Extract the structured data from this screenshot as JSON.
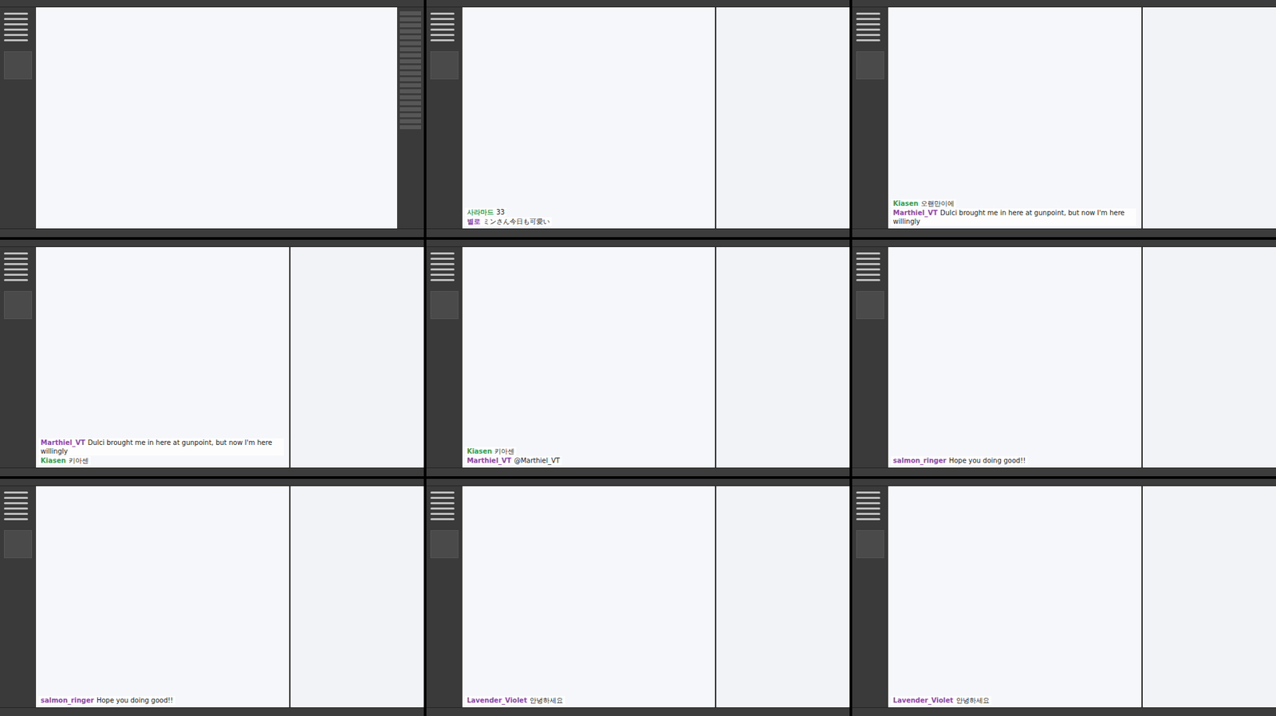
{
  "panels": [
    {
      "reference": false,
      "layers_panel": true,
      "chat": []
    },
    {
      "reference": true,
      "layers_panel": false,
      "chat": [
        {
          "user": "사라마드",
          "message": "33",
          "color": "#2e9e4f"
        },
        {
          "user": "별로",
          "message": "ミンさん今日も可愛い",
          "color": "#8e44ad"
        }
      ]
    },
    {
      "reference": true,
      "layers_panel": false,
      "chat": [
        {
          "user": "Kiasen",
          "message": "오랜만이에",
          "color": "#2e9e4f"
        },
        {
          "user": "Marthiel_VT",
          "message": "Dulci brought me in here at gunpoint, but now I'm here willingly",
          "color": "#8e44ad"
        }
      ]
    },
    {
      "reference": true,
      "layers_panel": false,
      "chat": [
        {
          "user": "Marthiel_VT",
          "message": "Dulci brought me in here at gunpoint, but now I'm here willingly",
          "color": "#8e44ad"
        },
        {
          "user": "Kiasen",
          "message": "키아센",
          "color": "#2e9e4f"
        }
      ]
    },
    {
      "reference": true,
      "layers_panel": false,
      "chat": [
        {
          "user": "Kiasen",
          "message": "키아센",
          "color": "#2e9e4f"
        },
        {
          "user": "Marthiel_VT",
          "message": "@Marthiel_VT",
          "color": "#8e44ad"
        }
      ]
    },
    {
      "reference": true,
      "layers_panel": false,
      "chat": [
        {
          "user": "salmon_ringer",
          "message": "Hope you doing good!!",
          "color": "#8e44ad"
        }
      ]
    },
    {
      "reference": true,
      "layers_panel": false,
      "chat": [
        {
          "user": "salmon_ringer",
          "message": "Hope you doing good!!",
          "color": "#8e44ad"
        }
      ]
    },
    {
      "reference": true,
      "layers_panel": false,
      "chat": [
        {
          "user": "Lavender_Violet",
          "message": "안녕하세요",
          "color": "#8e44ad"
        }
      ]
    },
    {
      "reference": true,
      "layers_panel": false,
      "chat": [
        {
          "user": "Lavender_Violet",
          "message": "안녕하세요",
          "color": "#8e44ad"
        }
      ]
    }
  ]
}
